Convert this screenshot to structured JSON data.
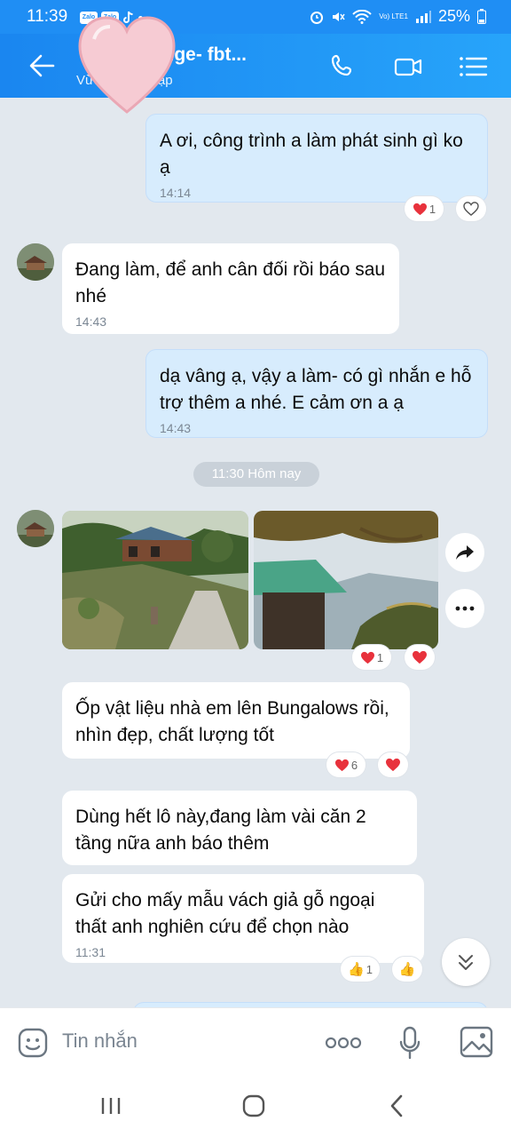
{
  "status": {
    "time": "11:39",
    "battery": "25%",
    "app_icons": [
      "zalo-icon",
      "zalo-icon",
      "tiktok-icon"
    ],
    "network": "Vo) LTE1"
  },
  "header": {
    "title": "olodge- fbt...",
    "subtitle_left": "Vừa",
    "subtitle_right": "cập"
  },
  "messages": {
    "m1": {
      "text": "A ơi, công trình a làm phát sinh gì ko ạ",
      "time": "14:14",
      "reaction_count": "1"
    },
    "m2": {
      "text": "Đang làm, để anh cân đối rồi báo sau nhé",
      "time": "14:43"
    },
    "m3": {
      "text": "dạ vâng ạ, vậy a làm- có gì nhắn e hỗ trợ thêm a nhé. E cảm ơn a ạ",
      "time": "14:43"
    },
    "date_divider": "11:30 Hôm nay",
    "photos": {
      "reaction_count": "1"
    },
    "m4": {
      "text": "Ốp vật liệu nhà em lên Bungalows rồi, nhìn đẹp, chất lượng tốt",
      "reaction_count": "6"
    },
    "m5": {
      "text": "Dùng hết lô này,đang làm vài căn 2 tầng nữa anh báo thêm"
    },
    "m6": {
      "text": "Gửi cho mấy mẫu vách giả gỗ ngoại thất anh nghiên cứu để chọn nào",
      "time": "11:31",
      "reaction_count": "1"
    }
  },
  "input": {
    "placeholder": "Tin nhắn"
  },
  "colors": {
    "header_blue": "#1f8ef4",
    "my_bubble": "#d7ecfd",
    "chat_bg": "#e2e8ee",
    "heart_red": "#e8323c"
  }
}
